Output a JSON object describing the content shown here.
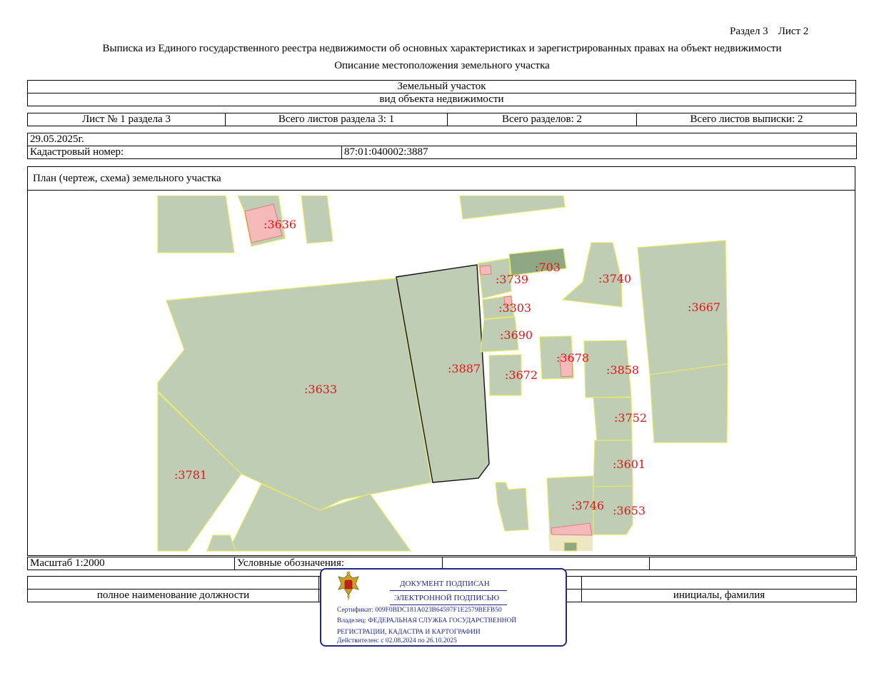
{
  "header": {
    "section": "Раздел 3",
    "sheet": "Лист 2",
    "title": "Выписка из Единого государственного реестра недвижимости об основных характеристиках и зарегистрированных правах на объект недвижимости",
    "subtitle": "Описание местоположения земельного участка"
  },
  "object": {
    "type_value": "Земельный участок",
    "type_caption": "вид объекта недвижимости"
  },
  "sheets": {
    "sheet_no": "Лист № 1 раздела 3",
    "total_section_sheets": "Всего листов раздела 3: 1",
    "total_sections": "Всего разделов: 2",
    "total_extract_sheets": "Всего листов выписки: 2"
  },
  "info": {
    "date": "29.05.2025г.",
    "cadastral_label": "Кадастровый номер:",
    "cadastral_value": "87:01:040002:3887"
  },
  "plan": {
    "title": "План (чертеж, схема) земельного участка",
    "labels": [
      ":3636",
      ":703",
      ":3739",
      ":3740",
      ":3667",
      ":3303",
      ":3690",
      ":3678",
      ":3887",
      ":3858",
      ":3672",
      ":3633",
      ":3752",
      ":3601",
      ":3781",
      ":3746",
      ":3653"
    ]
  },
  "footer": {
    "scale": "Масштаб 1:2000",
    "legend": "Условные обозначения:",
    "position_caption": "полное наименование должности",
    "name_caption": "инициалы, фамилия"
  },
  "stamp": {
    "line1": "ДОКУМЕНТ ПОДПИСАН",
    "line2": "ЭЛЕКТРОННОЙ ПОДПИСЬЮ",
    "certificate": "Сертификат: 009F0BDC181A023B64597F1E2579BEFB50",
    "owner_1": "Владелец: ФЕДЕРАЛЬНАЯ СЛУЖБА ГОСУДАРСТВЕННОЙ",
    "owner_2": "РЕГИСТРАЦИИ, КАДАСТРА И КАРТОГРАФИИ",
    "validity": "Действителен: с 02.08.2024 по 26.10.2025",
    "color": "#1f2a86"
  },
  "colors": {
    "parcel_fill": "#bfcdb4",
    "parcel_border": "#e4e86a",
    "label": "#e0161b",
    "building": "#f6b9b9"
  }
}
